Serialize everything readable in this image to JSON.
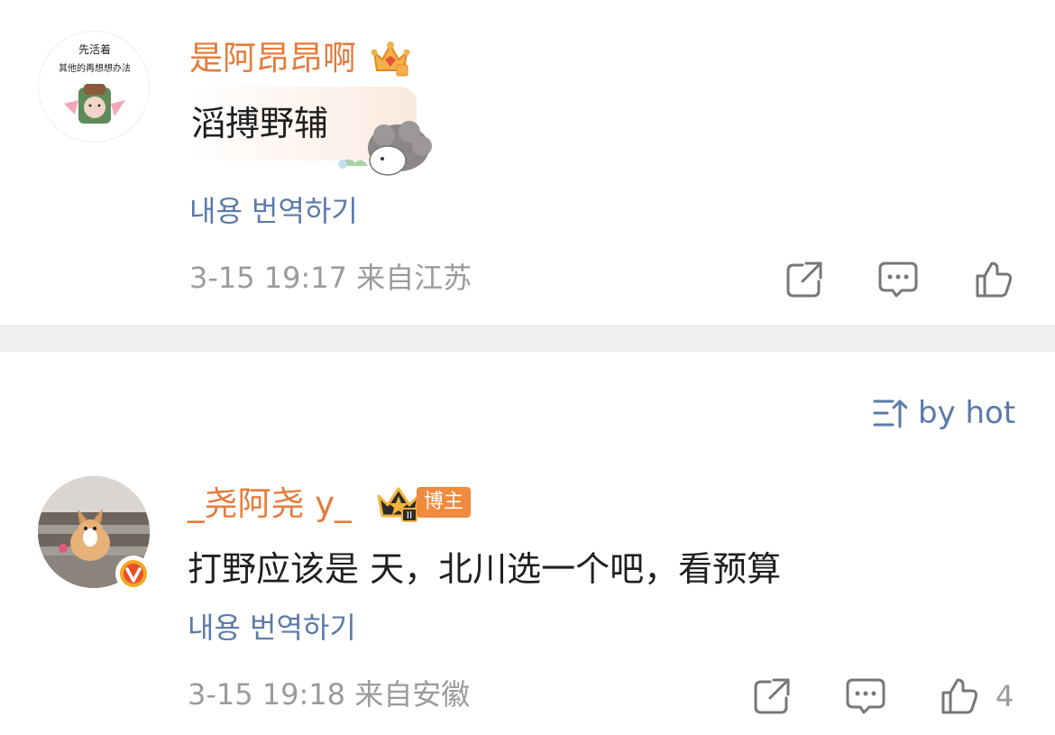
{
  "comments": [
    {
      "username": "是阿昂昂啊",
      "avatar_text_line1": "先活着",
      "avatar_text_line2": "其他的再想想办法",
      "content": "滔搏野辅",
      "translate": "내용 번역하기",
      "meta": "3-15 19:17  来自江苏"
    },
    {
      "username": "_尧阿尧 y_",
      "badge": "博主",
      "content": "打野应该是 天，北川选一个吧，看预算",
      "translate": "내용 번역하기",
      "meta": "3-15 19:18  来自安徽",
      "like_count": "4"
    }
  ],
  "sort": {
    "label": "by hot"
  },
  "colors": {
    "username": "#e57b3a",
    "link": "#5b7aa9",
    "meta": "#9b9b9b",
    "divider": "#efefef",
    "badge": "#f08a3c"
  },
  "icons": [
    "share-icon",
    "reply-icon",
    "like-icon",
    "crown-icon",
    "verified-icon",
    "sort-icon"
  ]
}
